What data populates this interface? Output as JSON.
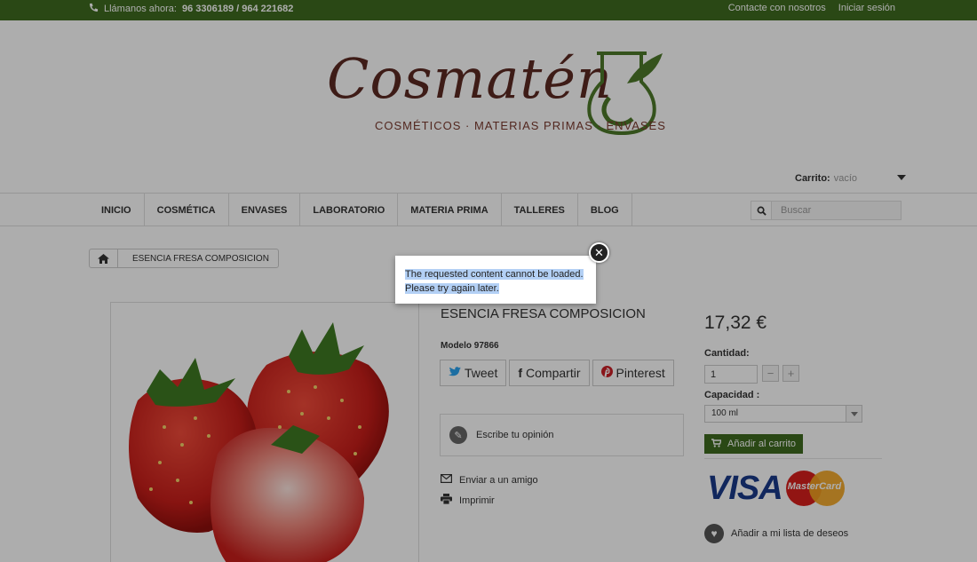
{
  "topbar": {
    "call_label": "Llámanos ahora:",
    "phones": "96 3306189 / 964 221682",
    "contact": "Contacte con nosotros",
    "login": "Iniciar sesión"
  },
  "logo": {
    "brand": "Cosmatén",
    "tagline": "COSMÉTICOS · MATERIAS PRIMAS · ENVASES"
  },
  "cart": {
    "label": "Carrito:",
    "value": "vacío"
  },
  "nav": [
    "INICIO",
    "COSMÉTICA",
    "ENVASES",
    "LABORATORIO",
    "MATERIA PRIMA",
    "TALLERES",
    "BLOG"
  ],
  "search": {
    "placeholder": "Buscar"
  },
  "breadcrumb": {
    "current": "ESENCIA FRESA COMPOSICION"
  },
  "product": {
    "title": "ESENCIA FRESA COMPOSICION",
    "model_label": "Modelo",
    "model_value": "97866",
    "price": "17,32 €",
    "qty_label": "Cantidad:",
    "qty_value": "1",
    "capacity_label": "Capacidad :",
    "capacity_value": "100 ml",
    "add_to_cart": "Añadir al carrito",
    "review": "Escribe tu opinión",
    "send_friend": "Enviar a un amigo",
    "print": "Imprimir",
    "wishlist": "Añadir a mi lista de deseos"
  },
  "social": {
    "tweet": "Tweet",
    "share": "Compartir",
    "pinterest": "Pinterest"
  },
  "cards": {
    "visa": "VISA",
    "mastercard": "MasterCard"
  },
  "modal": {
    "line1": "The requested content cannot be loaded.",
    "line2": "Please try again later."
  },
  "colors": {
    "brand_green": "#3e6b1f",
    "brand_brown": "#5c2a23"
  }
}
